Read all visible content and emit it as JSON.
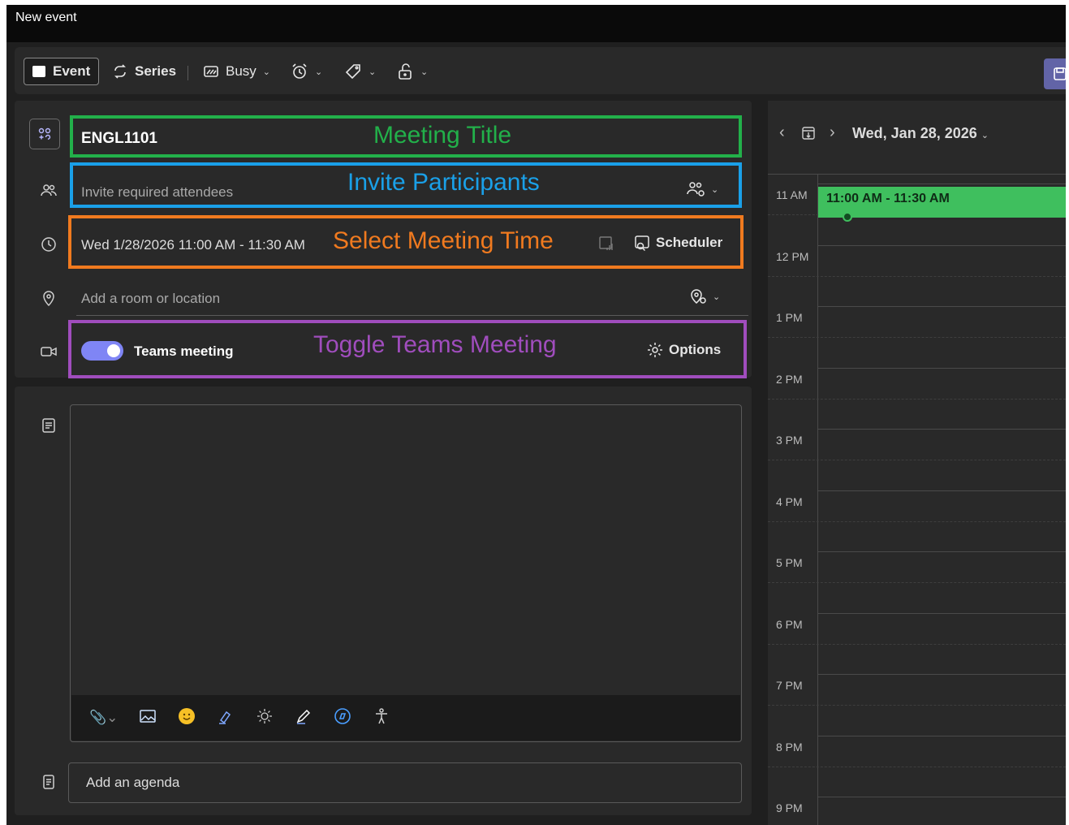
{
  "window": {
    "title": "New event"
  },
  "toolbar": {
    "event_label": "Event",
    "series_label": "Series",
    "busy_label": "Busy"
  },
  "form": {
    "title_value": "ENGL1101",
    "attendees_placeholder": "Invite required attendees",
    "datetime_value": "Wed 1/28/2026 11:00 AM - 11:30 AM",
    "scheduler_label": "Scheduler",
    "location_placeholder": "Add a room or location",
    "teams_label": "Teams meeting",
    "options_label": "Options"
  },
  "annotations": {
    "meeting_title": "Meeting Title",
    "invite_participants": "Invite Participants",
    "select_time": "Select Meeting Time",
    "toggle_teams": "Toggle Teams Meeting"
  },
  "annotation_colors": {
    "meeting_title": "#22b04a",
    "invite_participants": "#1aa0e8",
    "select_time": "#f07a1f",
    "toggle_teams": "#a04dbd"
  },
  "body": {
    "agenda_placeholder": "Add an agenda"
  },
  "calendar": {
    "date_label": "Wed, Jan 28, 2026",
    "hours": [
      "11 AM",
      "12 PM",
      "1 PM",
      "2 PM",
      "3 PM",
      "4 PM",
      "5 PM",
      "6 PM",
      "7 PM",
      "8 PM",
      "9 PM"
    ],
    "event_time": "11:00 AM - 11:30 AM",
    "event_color": "#3fbf5e"
  }
}
